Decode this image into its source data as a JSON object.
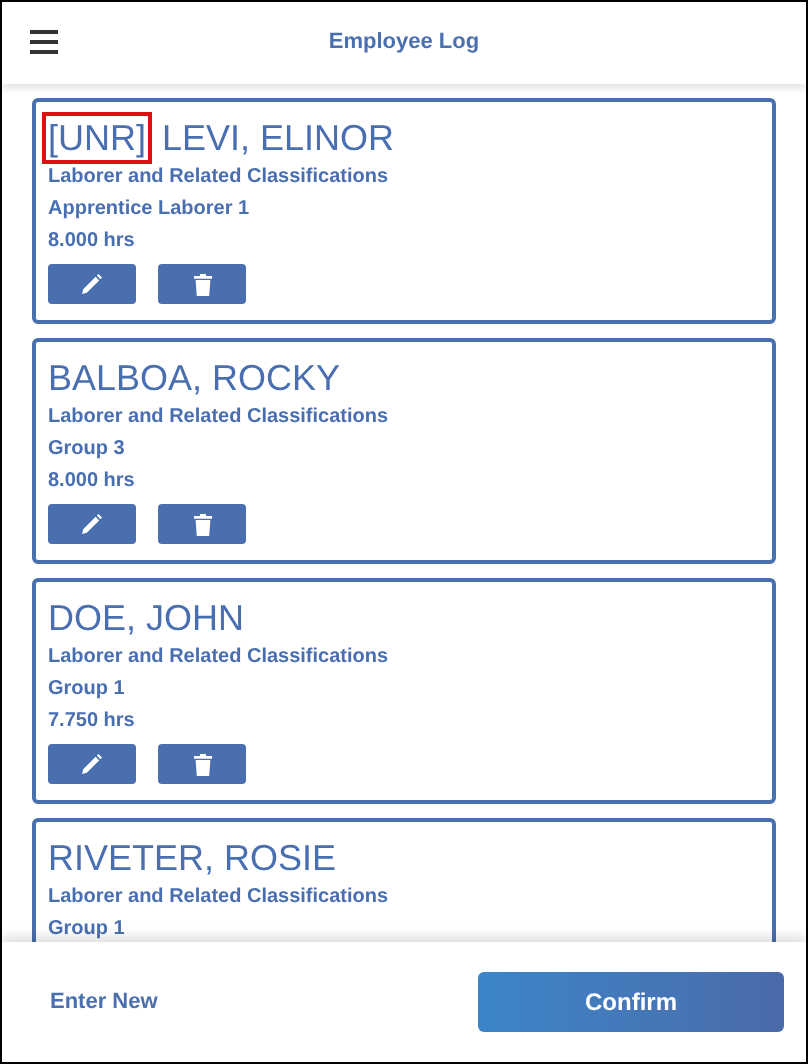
{
  "header": {
    "title": "Employee Log"
  },
  "employees": [
    {
      "tag": "[UNR]",
      "tag_highlighted": true,
      "name": "LEVI, ELINOR",
      "classification": "Laborer and Related Classifications",
      "group": "Apprentice Laborer 1",
      "hours": "8.000 hrs",
      "actions": [
        {
          "kind": "edit"
        },
        {
          "kind": "delete"
        }
      ]
    },
    {
      "name": "BALBOA, ROCKY",
      "classification": "Laborer and Related Classifications",
      "group": "Group 3",
      "hours": "8.000 hrs",
      "actions": [
        {
          "kind": "edit"
        },
        {
          "kind": "delete"
        }
      ]
    },
    {
      "name": "DOE, JOHN",
      "classification": "Laborer and Related Classifications",
      "group": "Group 1",
      "hours": "7.750 hrs",
      "actions": [
        {
          "kind": "edit"
        },
        {
          "kind": "delete"
        }
      ]
    },
    {
      "name": "RIVETER, ROSIE",
      "classification": "Laborer and Related Classifications",
      "group": "Group 1"
    }
  ],
  "footer": {
    "link": "Enter New",
    "button": "Confirm"
  }
}
